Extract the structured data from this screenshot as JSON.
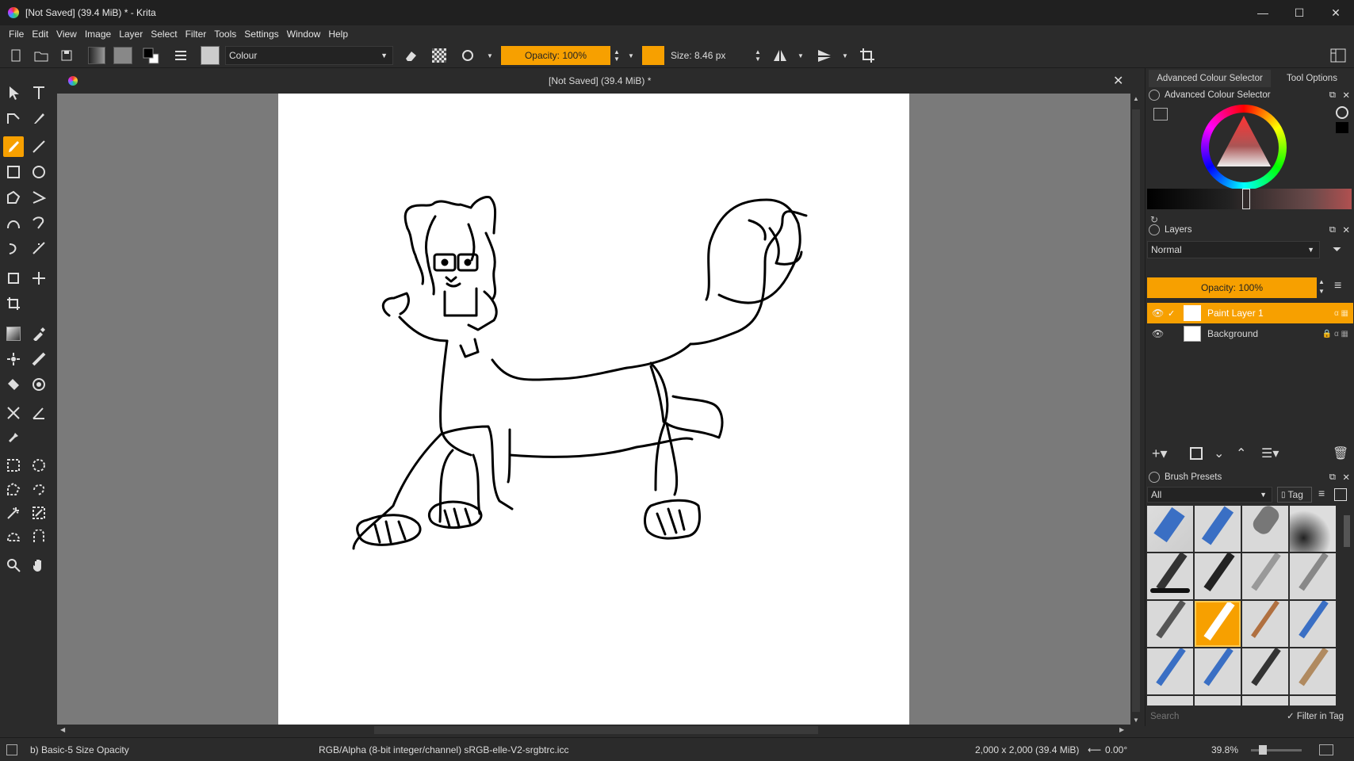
{
  "window": {
    "title": "[Not Saved]  (39.4 MiB) * - Krita"
  },
  "menu": [
    "File",
    "Edit",
    "View",
    "Image",
    "Layer",
    "Select",
    "Filter",
    "Tools",
    "Settings",
    "Window",
    "Help"
  ],
  "toolbar": {
    "blend_mode": "Colour",
    "opacity": "Opacity: 100%",
    "size": "Size: 8.46 px"
  },
  "document": {
    "tab_title": "[Not Saved]  (39.4 MiB) *"
  },
  "dock": {
    "tabs": [
      "Advanced Colour Selector",
      "Tool Options"
    ],
    "colour_selector_title": "Advanced Colour Selector",
    "layers_title": "Layers",
    "layers_blend": "Normal",
    "layers_opacity": "Opacity:  100%",
    "layers": [
      {
        "name": "Paint Layer 1",
        "selected": true
      },
      {
        "name": "Background",
        "selected": false
      }
    ],
    "brush_presets_title": "Brush Presets",
    "brush_filter": "All",
    "brush_tag": "Tag",
    "search_placeholder": "Search",
    "filter_in_tag": "Filter in Tag"
  },
  "status": {
    "brush": "b) Basic-5 Size Opacity",
    "colorspace": "RGB/Alpha (8-bit integer/channel)  sRGB-elle-V2-srgbtrc.icc",
    "dimensions": "2,000 x 2,000 (39.4 MiB)",
    "rotation": "0.00°",
    "zoom": "39.8%"
  },
  "colors": {
    "accent": "#f7a000",
    "background": "#2b2b2b",
    "canvas_surround": "#7a7a7a"
  }
}
